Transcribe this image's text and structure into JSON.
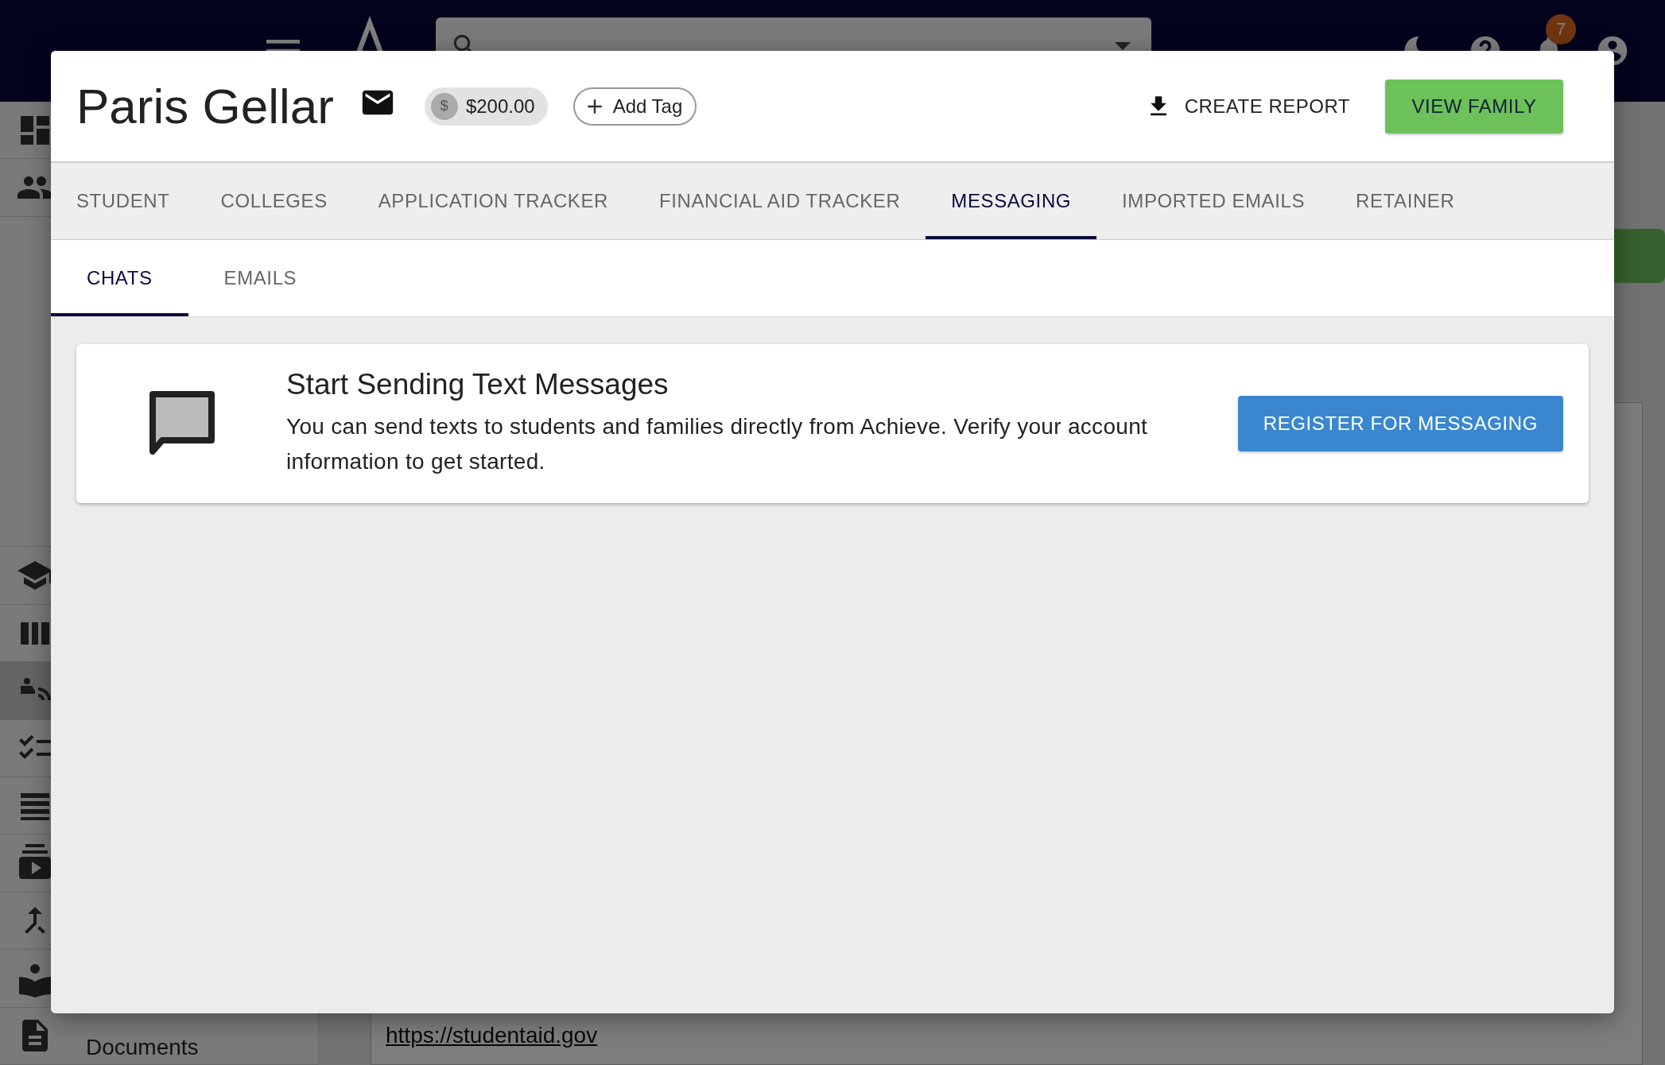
{
  "topbar": {
    "notifications": {
      "count": "7"
    }
  },
  "sidebar": {
    "items": [
      {
        "selected": false
      },
      {
        "selected": false
      },
      {
        "selected": false
      },
      {
        "selected": false
      },
      {
        "selected": true
      },
      {
        "selected": false
      },
      {
        "selected": false
      },
      {
        "selected": false
      },
      {
        "selected": false
      },
      {
        "selected": false
      }
    ],
    "documents": {
      "label": "Documents",
      "selected": false
    }
  },
  "page": {
    "link": "https://studentaid.gov"
  },
  "modal": {
    "title": "Paris Gellar",
    "balance_chip": {
      "avatar": "$",
      "label": "$200.00"
    },
    "tag_chip": {
      "label": "Add Tag"
    },
    "actions": [
      {
        "kind": "text",
        "label": "CREATE REPORT"
      },
      {
        "kind": "filled",
        "label": "VIEW FAMILY"
      }
    ],
    "tabs": [
      {
        "label": "STUDENT",
        "selected": false
      },
      {
        "label": "COLLEGES",
        "selected": false
      },
      {
        "label": "APPLICATION TRACKER",
        "selected": false
      },
      {
        "label": "FINANCIAL AID TRACKER",
        "selected": false
      },
      {
        "label": "MESSAGING",
        "selected": true
      },
      {
        "label": "IMPORTED EMAILS",
        "selected": false
      },
      {
        "label": "RETAINER",
        "selected": false
      }
    ],
    "subtabs": [
      {
        "label": "CHATS",
        "selected": true
      },
      {
        "label": "EMAILS",
        "selected": false
      }
    ],
    "banner": {
      "heading": "Start Sending Text Messages",
      "body": "You can send texts to students and families directly from Achieve. Verify your account information to get started.",
      "button": "REGISTER FOR MESSAGING"
    }
  }
}
